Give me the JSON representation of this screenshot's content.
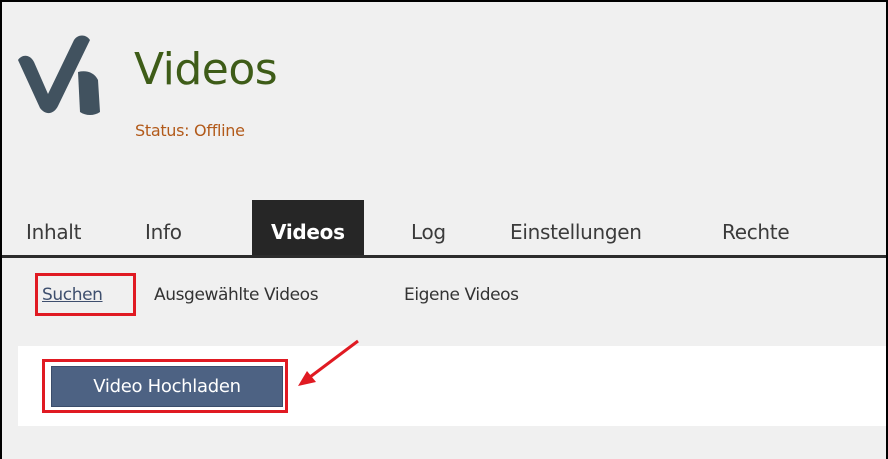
{
  "header": {
    "title": "Videos",
    "status": "Status: Offline"
  },
  "tabs": [
    {
      "label": "Inhalt",
      "active": false
    },
    {
      "label": "Info",
      "active": false
    },
    {
      "label": "Videos",
      "active": true
    },
    {
      "label": "Log",
      "active": false
    },
    {
      "label": "Einstellungen",
      "active": false
    },
    {
      "label": "Rechte",
      "active": false
    }
  ],
  "subnav": [
    {
      "label": "Suchen",
      "active": true
    },
    {
      "label": "Ausgewählte Videos",
      "active": false
    },
    {
      "label": "Eigene Videos",
      "active": false
    }
  ],
  "actions": {
    "upload_label": "Video Hochladen"
  },
  "colors": {
    "title": "#3e5c18",
    "status": "#b25a1a",
    "active_tab_bg": "#262626",
    "button_bg": "#4d6283",
    "highlight": "#e01a22"
  }
}
